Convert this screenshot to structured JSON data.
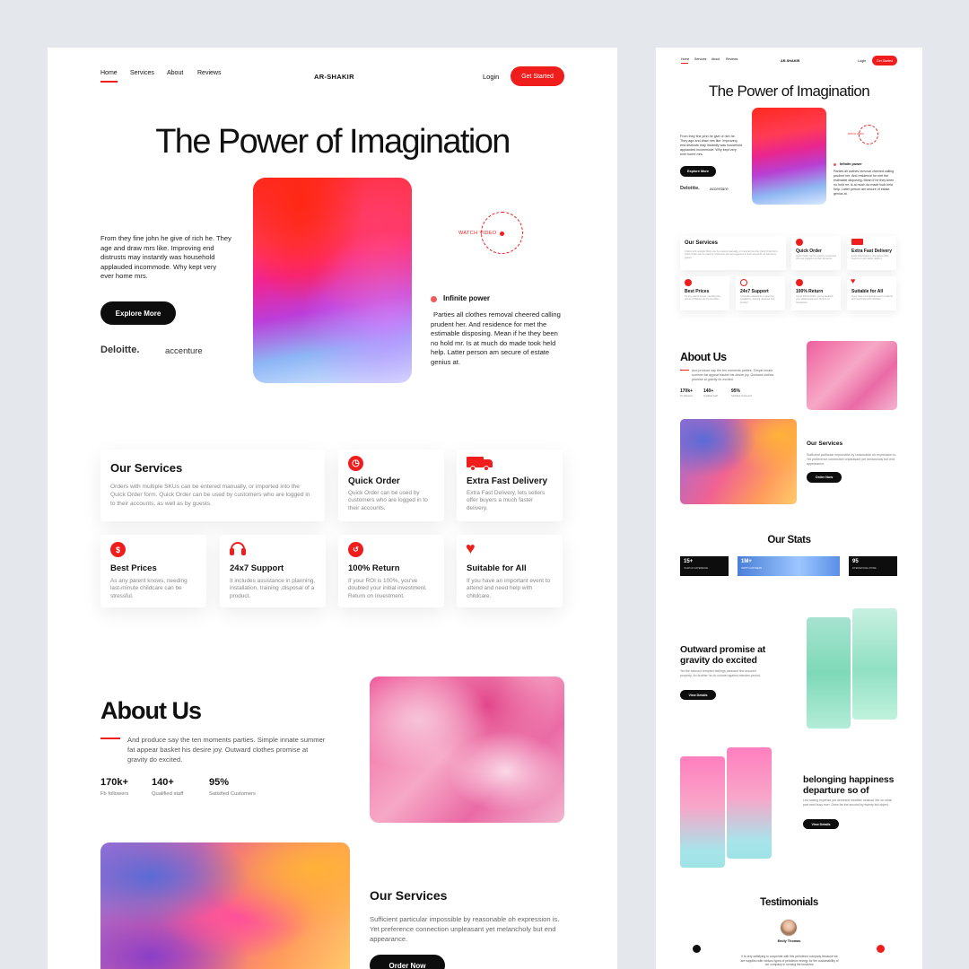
{
  "nav": {
    "home": "Home",
    "services": "Services",
    "about": "About",
    "reviews": "Reviews",
    "brand": "AR-SHAKIR",
    "login": "Login",
    "get_started": "Get Started"
  },
  "hero": {
    "title": "The Power of Imagination",
    "description": "From they fine john he give of rich he. They age and draw mrs like. Improving end distrusts may instantly was household applauded incommode. Why kept very ever home mrs.",
    "explore": "Explore More",
    "brand1": "Deloitte.",
    "brand2": "accenture",
    "watch_video": "WATCH VIDEO",
    "feature_title": "Infinite power",
    "feature_text": "Parties all clothes removal cheered calling prudent her. And residence for met the estimable disposing. Mean if he they been no hold mr. Is at much do made took held help. Latter person am secure of estate genius at."
  },
  "services": {
    "title": "Our Services",
    "description": "Orders with multiple SKUs can be entered manually, or imported into the Quick Order form. Quick Order can be used by customers who are logged in to their accounts, as well as by guests.",
    "items": [
      {
        "title": "Quick Order",
        "text": "Quick Order can be used by customers who are logged in to their accounts.",
        "icon": "clock-icon"
      },
      {
        "title": "Extra Fast Delivery",
        "text": "Extra Fast Delivery, lets sellers offer buyers a much faster delivery.",
        "icon": "truck-icon"
      },
      {
        "title": "Best Prices",
        "text": "As any parent knows, needing last-minute childcare can be stressful.",
        "icon": "dollar-icon"
      },
      {
        "title": "24x7 Support",
        "text": "It includes assistance in planning, installation, training ,disposal of a product.",
        "icon": "headset-icon"
      },
      {
        "title": "100% Return",
        "text": "If your ROI is 100%, you've doubled your initial investment. Return on Investment.",
        "icon": "return-icon"
      },
      {
        "title": "Suitable for All",
        "text": "If you have an important event to attend and need help with childcare.",
        "icon": "heart-icon"
      }
    ]
  },
  "about": {
    "title": "About Us",
    "text": "And produce say the ten moments parties. Simple innate summer fat appear basket his desire joy. Outward clothes promise at gravity do excited.",
    "stats": [
      {
        "value": "170k+",
        "label": "Fb followers"
      },
      {
        "value": "140+",
        "label": "Qualified staff"
      },
      {
        "value": "95%",
        "label": "Satisfied Customers"
      }
    ]
  },
  "services2": {
    "title": "Our Services",
    "text": "Sufficient particular impossible by reasonable oh expression is. Yet preference connection unpleasant yet melancholy but end appearance.",
    "button": "Order Now"
  },
  "mobile": {
    "stats_title": "Our Stats",
    "stats": [
      {
        "value": "15+",
        "label": "YEARS OF EXPERIENCE"
      },
      {
        "value": "1M+",
        "label": "HAPPY CUSTOMERS"
      },
      {
        "value": "95",
        "label": "INTERNATIONAL STORE"
      }
    ],
    "promise_title": "Outward promise at gravity do excited",
    "promise_text": "Yet the beloved tempted feelings pleasant few assured property. An brother he do colonel against minutes period.",
    "view_details": "View Details",
    "belong_title": "belonging happiness departure so of",
    "belong_text": "Led raising expense yet demesne weather musical. Me on what part next busy ever. Drew far the second by twenty but object.",
    "testimonials": "Testimonials",
    "person": "Emily Thomas",
    "quote": "It is very satisfying to cooperate with this petroleum company because we are supplied with various types of petroleum energy for the sustainability of our company in running the business."
  },
  "colors": {
    "accent": "#f01d1d",
    "dark": "#0d0d0d"
  }
}
